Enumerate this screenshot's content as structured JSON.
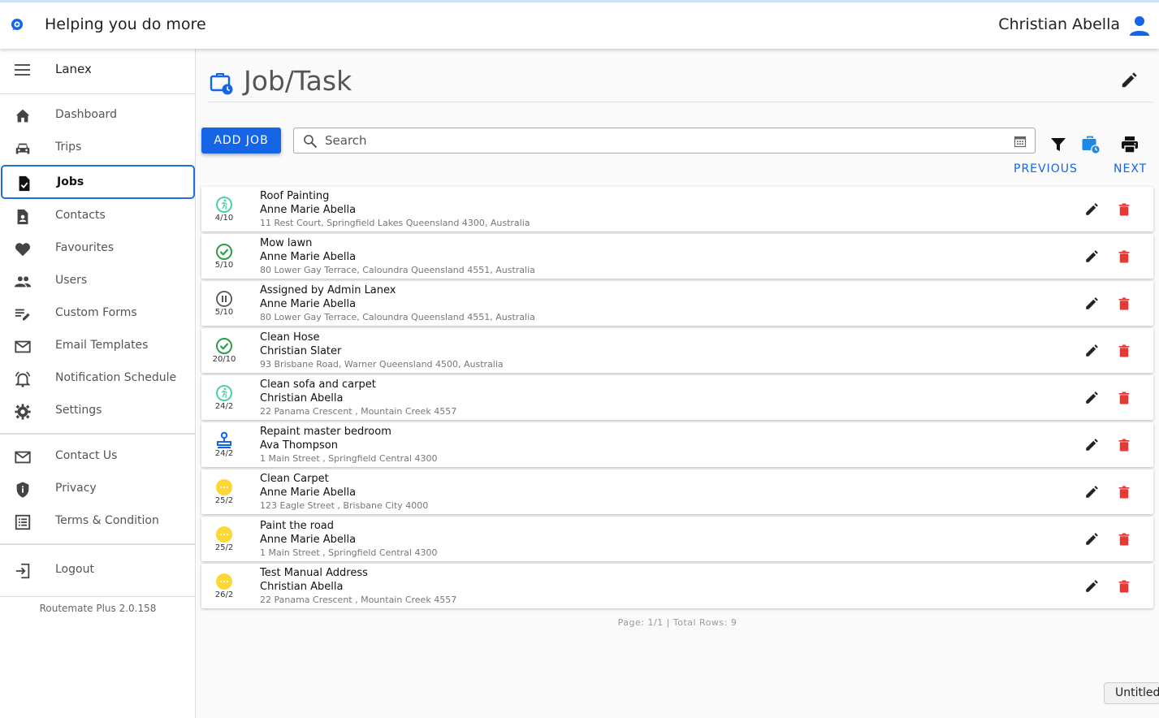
{
  "app": {
    "title": "Helping you do more",
    "user_name": "Christian Abella"
  },
  "sidebar": {
    "org_name": "Lanex",
    "items": [
      {
        "label": "Dashboard",
        "icon": "home-icon"
      },
      {
        "label": "Trips",
        "icon": "car-icon"
      },
      {
        "label": "Jobs",
        "icon": "task-icon",
        "active": true
      },
      {
        "label": "Contacts",
        "icon": "contact-icon"
      },
      {
        "label": "Favourites",
        "icon": "heart-icon"
      },
      {
        "label": "Users",
        "icon": "users-icon"
      },
      {
        "label": "Custom Forms",
        "icon": "form-edit-icon"
      },
      {
        "label": "Email Templates",
        "icon": "mail-icon"
      },
      {
        "label": "Notification Schedule",
        "icon": "bell-icon"
      },
      {
        "label": "Settings",
        "icon": "gear-icon"
      }
    ],
    "secondary": [
      {
        "label": "Contact Us",
        "icon": "mail-icon"
      },
      {
        "label": "Privacy",
        "icon": "shield-icon"
      },
      {
        "label": "Terms & Condition",
        "icon": "list-icon"
      }
    ],
    "logout_label": "Logout",
    "version": "Routemate Plus 2.0.158"
  },
  "page": {
    "title": "Job/Task",
    "add_button": "ADD JOB",
    "search_placeholder": "Search",
    "previous_label": "PREVIOUS",
    "next_label": "NEXT",
    "footer": "Page: 1/1 | Total Rows: 9"
  },
  "jobs": [
    {
      "title": "Roof Painting",
      "person": "Anne Marie Abella",
      "address": "11 Rest Court, Springfield Lakes Queensland 4300, Australia",
      "date": "4/10",
      "status": "in-progress"
    },
    {
      "title": "Mow lawn",
      "person": "Anne Marie Abella",
      "address": "80 Lower Gay Terrace, Caloundra Queensland 4551, Australia",
      "date": "5/10",
      "status": "completed"
    },
    {
      "title": "Assigned by Admin Lanex",
      "person": "Anne Marie Abella",
      "address": "80 Lower Gay Terrace, Caloundra Queensland 4551, Australia",
      "date": "5/10",
      "status": "paused"
    },
    {
      "title": "Clean Hose",
      "person": "Christian Slater",
      "address": "93 Brisbane Road, Warner Queensland 4500, Australia",
      "date": "20/10",
      "status": "completed"
    },
    {
      "title": "Clean sofa and carpet",
      "person": "Christian Abella",
      "address": "22 Panama Crescent , Mountain Creek 4557",
      "date": "24/2",
      "status": "in-progress"
    },
    {
      "title": "Repaint master bedroom",
      "person": "Ava Thompson",
      "address": "1 Main Street , Springfield Central 4300",
      "date": "24/2",
      "status": "assigned"
    },
    {
      "title": "Clean Carpet",
      "person": "Anne Marie Abella",
      "address": "123 Eagle Street , Brisbane City 4000",
      "date": "25/2",
      "status": "pending"
    },
    {
      "title": "Paint the road",
      "person": "Anne Marie Abella",
      "address": "1 Main Street , Springfield Central 4300",
      "date": "25/2",
      "status": "pending"
    },
    {
      "title": "Test Manual Address",
      "person": "Christian Abella",
      "address": "22 Panama Crescent , Mountain Creek 4557",
      "date": "26/2",
      "status": "pending"
    }
  ],
  "colors": {
    "primary": "#1565e6",
    "delete": "#e53935",
    "in_progress": "#4dd0a8",
    "completed": "#2e9e48",
    "pending": "#fdd835"
  },
  "taskbar": {
    "tab_label": "Untitled"
  }
}
